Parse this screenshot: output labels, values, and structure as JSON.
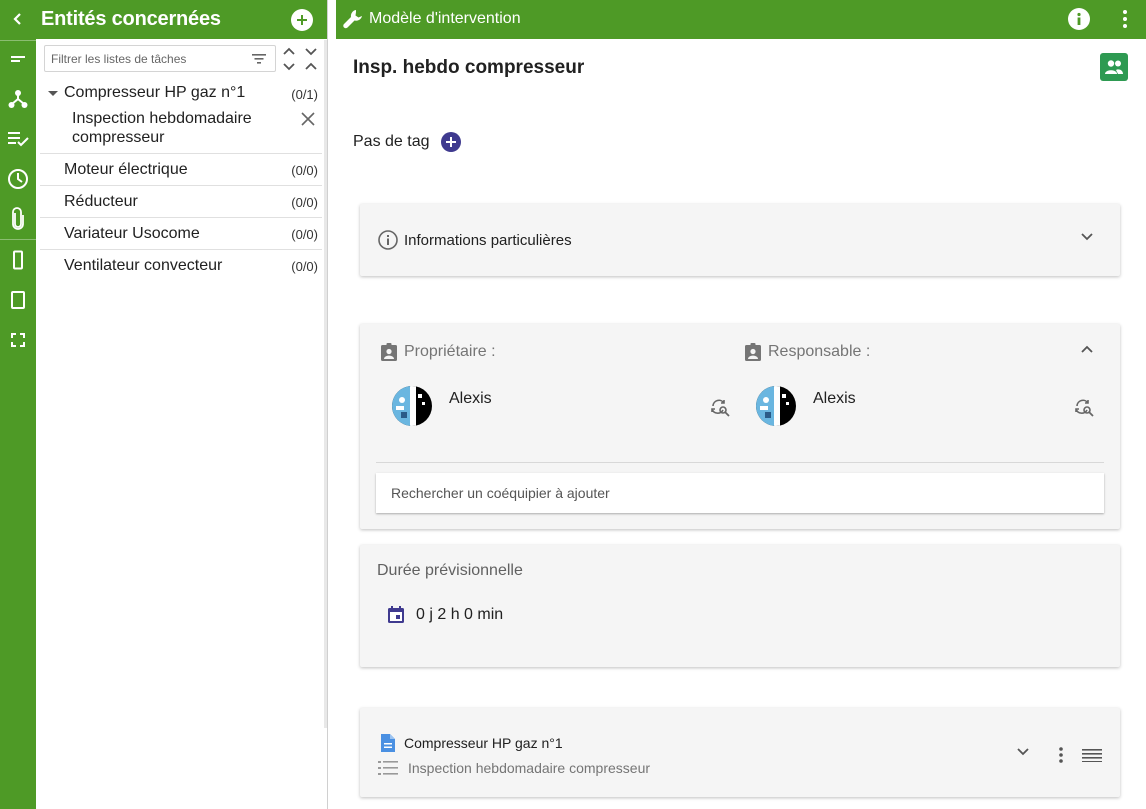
{
  "rail": {
    "items": [
      "back-icon",
      "short-text-icon",
      "hierarchy-icon",
      "playlist-check-icon",
      "clock-icon",
      "paperclip-icon",
      "phone-portrait-icon",
      "tablet-icon",
      "fullscreen-icon"
    ]
  },
  "entities": {
    "title": "Entités concernées",
    "filter_placeholder": "Filtrer les listes de tâches",
    "items": [
      {
        "label": "Compresseur HP gaz n°1",
        "count": "(0/1)",
        "expanded": true,
        "tasks": [
          {
            "label": "Inspection hebdomadaire compresseur"
          }
        ]
      },
      {
        "label": "Moteur électrique",
        "count": "(0/0)"
      },
      {
        "label": "Réducteur",
        "count": "(0/0)"
      },
      {
        "label": "Variateur Usocome",
        "count": "(0/0)"
      },
      {
        "label": "Ventilateur convecteur",
        "count": "(0/0)"
      }
    ]
  },
  "header": {
    "title": "Modèle d'intervention"
  },
  "document": {
    "title": "Insp. hebdo compresseur",
    "tag_label": "Pas de tag"
  },
  "info_section": {
    "title": "Informations particulières"
  },
  "team": {
    "owner_label": "Propriétaire :",
    "owner_name": "Alexis",
    "manager_label": "Responsable :",
    "manager_name": "Alexis",
    "search_placeholder": "Rechercher un coéquipier à ajouter"
  },
  "duration": {
    "title": "Durée prévisionnelle",
    "value": "0 j 2 h 0 min"
  },
  "linked_doc": {
    "entity": "Compresseur HP gaz n°1",
    "task": "Inspection hebdomadaire compresseur"
  },
  "colors": {
    "brand_green": "#4e9a26",
    "team_button": "#2e9a52",
    "tag_add": "#3f3a8f"
  }
}
